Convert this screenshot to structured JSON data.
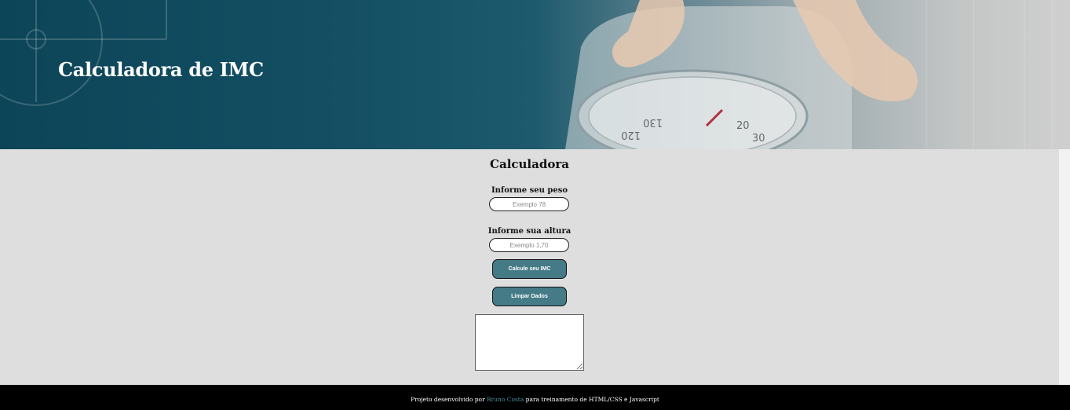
{
  "header": {
    "title": "Calculadora de IMC"
  },
  "main": {
    "heading": "Calculadora",
    "weight": {
      "label": "Informe seu peso",
      "placeholder": "Exemplo 78",
      "value": ""
    },
    "height": {
      "label": "Informe sua altura",
      "placeholder": "Exemplo 1,70",
      "value": ""
    },
    "calculate_button": "Calcule seu IMC",
    "clear_button": "Limpar Dados",
    "result": ""
  },
  "footer": {
    "prefix": "Projeto desenvolvido por ",
    "author": "Bruno Costa",
    "suffix": " para treinamento de HTML/CSS e Javascript"
  },
  "colors": {
    "header_dark": "#0d4558",
    "button": "#457b87",
    "background": "#dedede",
    "footer": "#000000",
    "link": "#4a8fa0"
  }
}
